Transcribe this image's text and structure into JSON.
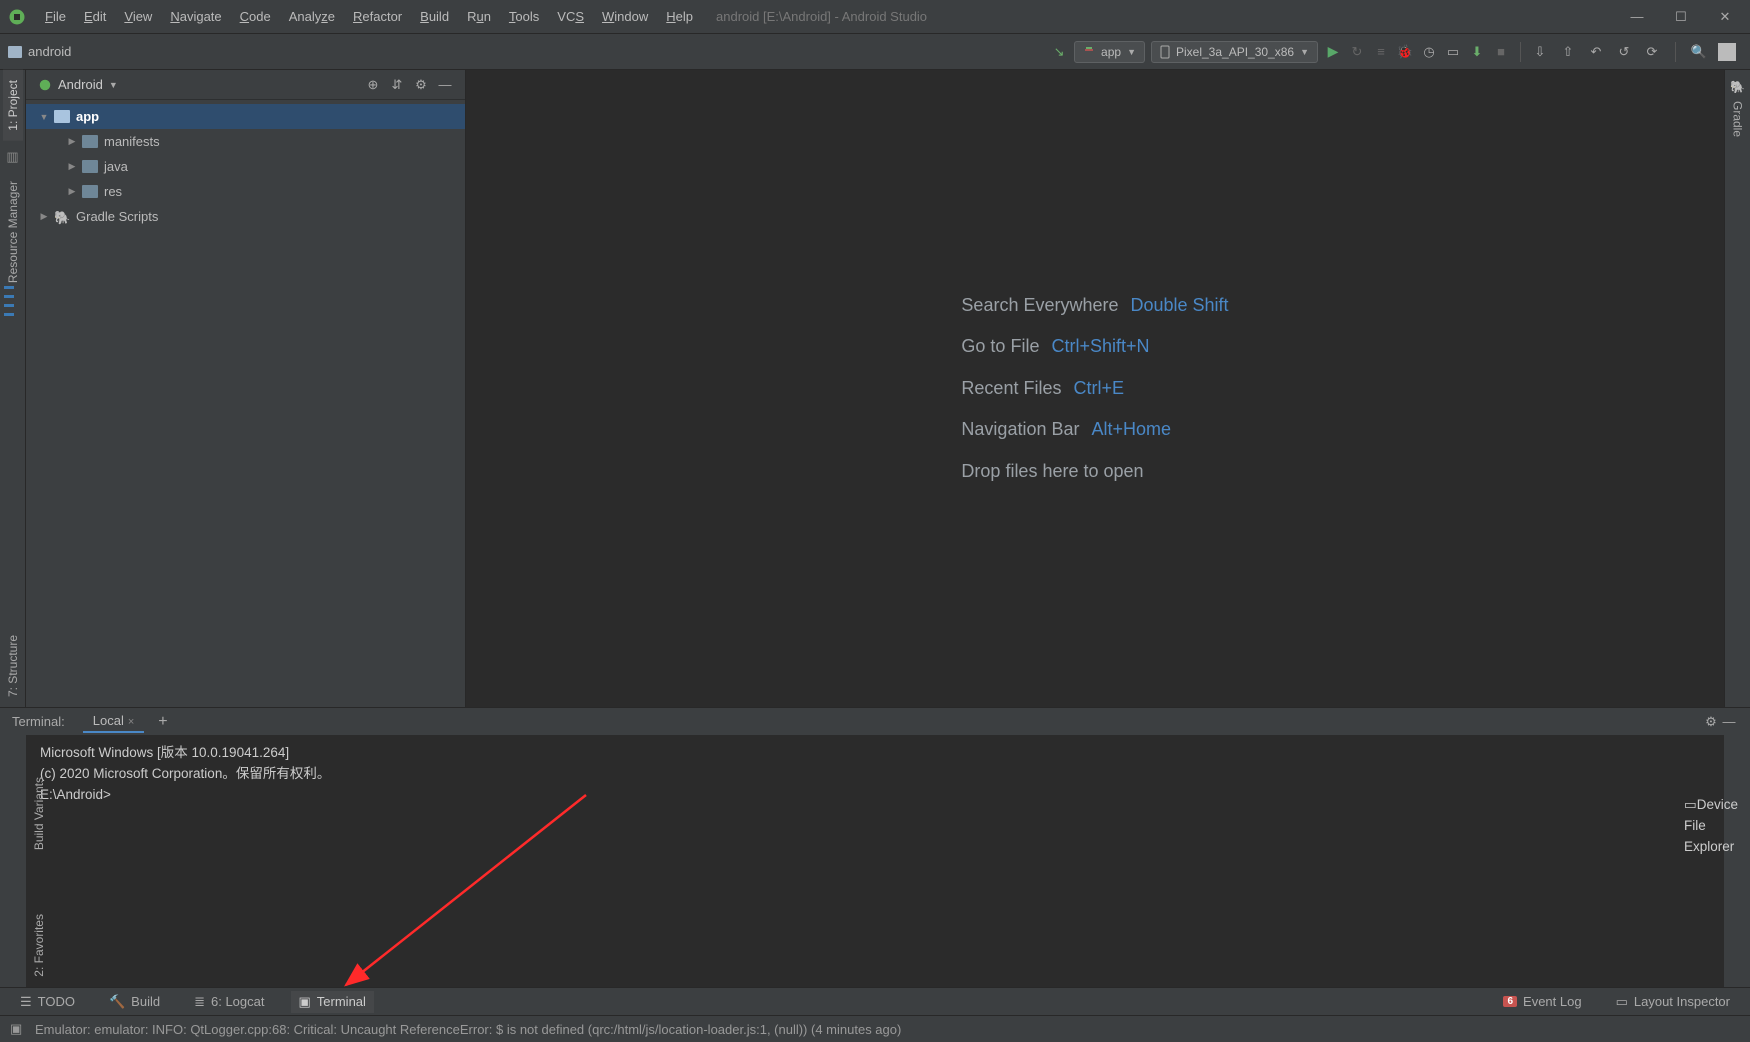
{
  "window": {
    "title": "android [E:\\Android] - Android Studio"
  },
  "menus": [
    "File",
    "Edit",
    "View",
    "Navigate",
    "Code",
    "Analyze",
    "Refactor",
    "Build",
    "Run",
    "Tools",
    "VCS",
    "Window",
    "Help"
  ],
  "breadcrumb": {
    "project": "android"
  },
  "run": {
    "config": "app",
    "device": "Pixel_3a_API_30_x86"
  },
  "project_panel": {
    "view": "Android",
    "items": [
      {
        "label": "app",
        "depth": 0,
        "expanded": true,
        "selected": true,
        "icon": "module"
      },
      {
        "label": "manifests",
        "depth": 1,
        "icon": "folder"
      },
      {
        "label": "java",
        "depth": 1,
        "icon": "folder"
      },
      {
        "label": "res",
        "depth": 1,
        "icon": "folder"
      },
      {
        "label": "Gradle Scripts",
        "depth": 0,
        "expanded": false,
        "icon": "gradle"
      }
    ]
  },
  "editor_hints": [
    {
      "label": "Search Everywhere",
      "key": "Double Shift"
    },
    {
      "label": "Go to File",
      "key": "Ctrl+Shift+N"
    },
    {
      "label": "Recent Files",
      "key": "Ctrl+E"
    },
    {
      "label": "Navigation Bar",
      "key": "Alt+Home"
    },
    {
      "label": "Drop files here to open",
      "key": ""
    }
  ],
  "left_stripe": [
    {
      "label": "1: Project",
      "active": true
    },
    {
      "label": "Resource Manager"
    },
    {
      "label": "7: Structure"
    },
    {
      "label": "2: Favorites"
    }
  ],
  "right_stripe": [
    {
      "label": "Gradle"
    },
    {
      "label": "Device File Explorer"
    }
  ],
  "terminal": {
    "title": "Terminal:",
    "tab": "Local",
    "lines": [
      "Microsoft Windows [版本 10.0.19041.264]",
      "(c) 2020 Microsoft Corporation。保留所有权利。",
      "",
      "E:\\Android>"
    ]
  },
  "bottom_tabs": [
    {
      "label": "TODO",
      "icon": "☰"
    },
    {
      "label": "Build",
      "icon": "🔨"
    },
    {
      "label": "6: Logcat",
      "icon": "≣"
    },
    {
      "label": "Terminal",
      "icon": "▣",
      "active": true
    }
  ],
  "bottom_right": [
    {
      "label": "Event Log",
      "icon": "badge"
    },
    {
      "label": "Layout Inspector",
      "icon": "▭"
    }
  ],
  "event_badge": "6",
  "status": "Emulator: emulator: INFO: QtLogger.cpp:68: Critical: Uncaught ReferenceError: $ is not defined (qrc:/html/js/location-loader.js:1, (null)) (4 minutes ago)",
  "left_vtab_build": "Build Variants"
}
